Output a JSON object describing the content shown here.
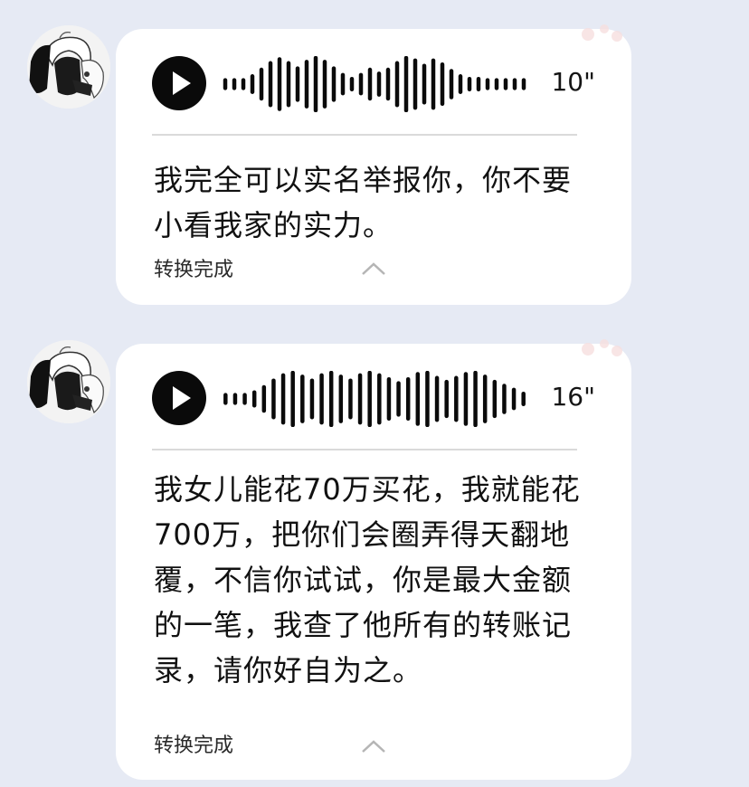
{
  "messages": [
    {
      "duration": "10\"",
      "transcript": "我完全可以实名举报你，你不要小看我家的实力。",
      "status": "转换完成",
      "waveform": [
        0.15,
        0.15,
        0.15,
        0.3,
        0.55,
        0.8,
        0.95,
        0.8,
        0.6,
        0.85,
        1.0,
        0.85,
        0.6,
        0.35,
        0.2,
        0.35,
        0.55,
        0.4,
        0.55,
        0.8,
        1.0,
        0.9,
        0.7,
        0.9,
        0.75,
        0.5,
        0.3,
        0.2,
        0.2,
        0.15,
        0.15,
        0.15,
        0.15,
        0.15
      ],
      "avatar_icon": "anime-girl-avatar-icon",
      "play_icon": "play-icon",
      "collapse_icon": "chevron-up-icon"
    },
    {
      "duration": "16\"",
      "transcript": "我女儿能花70万买花，我就能花700万，把你们会圈弄得天翻地覆，不信你试试，你是最大金额的一笔，我查了他所有的转账记录，请你好自为之。",
      "status": "转换完成",
      "waveform": [
        0.15,
        0.15,
        0.15,
        0.25,
        0.45,
        0.7,
        0.9,
        1.0,
        0.85,
        0.7,
        0.9,
        1.0,
        0.85,
        0.7,
        0.9,
        1.0,
        0.9,
        0.75,
        0.6,
        0.75,
        0.95,
        1.0,
        0.8,
        0.65,
        0.8,
        0.95,
        1.0,
        0.85,
        0.65,
        0.5,
        0.35,
        0.2
      ],
      "avatar_icon": "anime-girl-avatar-icon",
      "play_icon": "play-icon",
      "collapse_icon": "chevron-up-icon"
    }
  ],
  "colors": {
    "background": "#e6eaf4",
    "bubble": "#ffffff",
    "waveform": "#0a0a0a",
    "play_button": "#0a0a0a"
  }
}
